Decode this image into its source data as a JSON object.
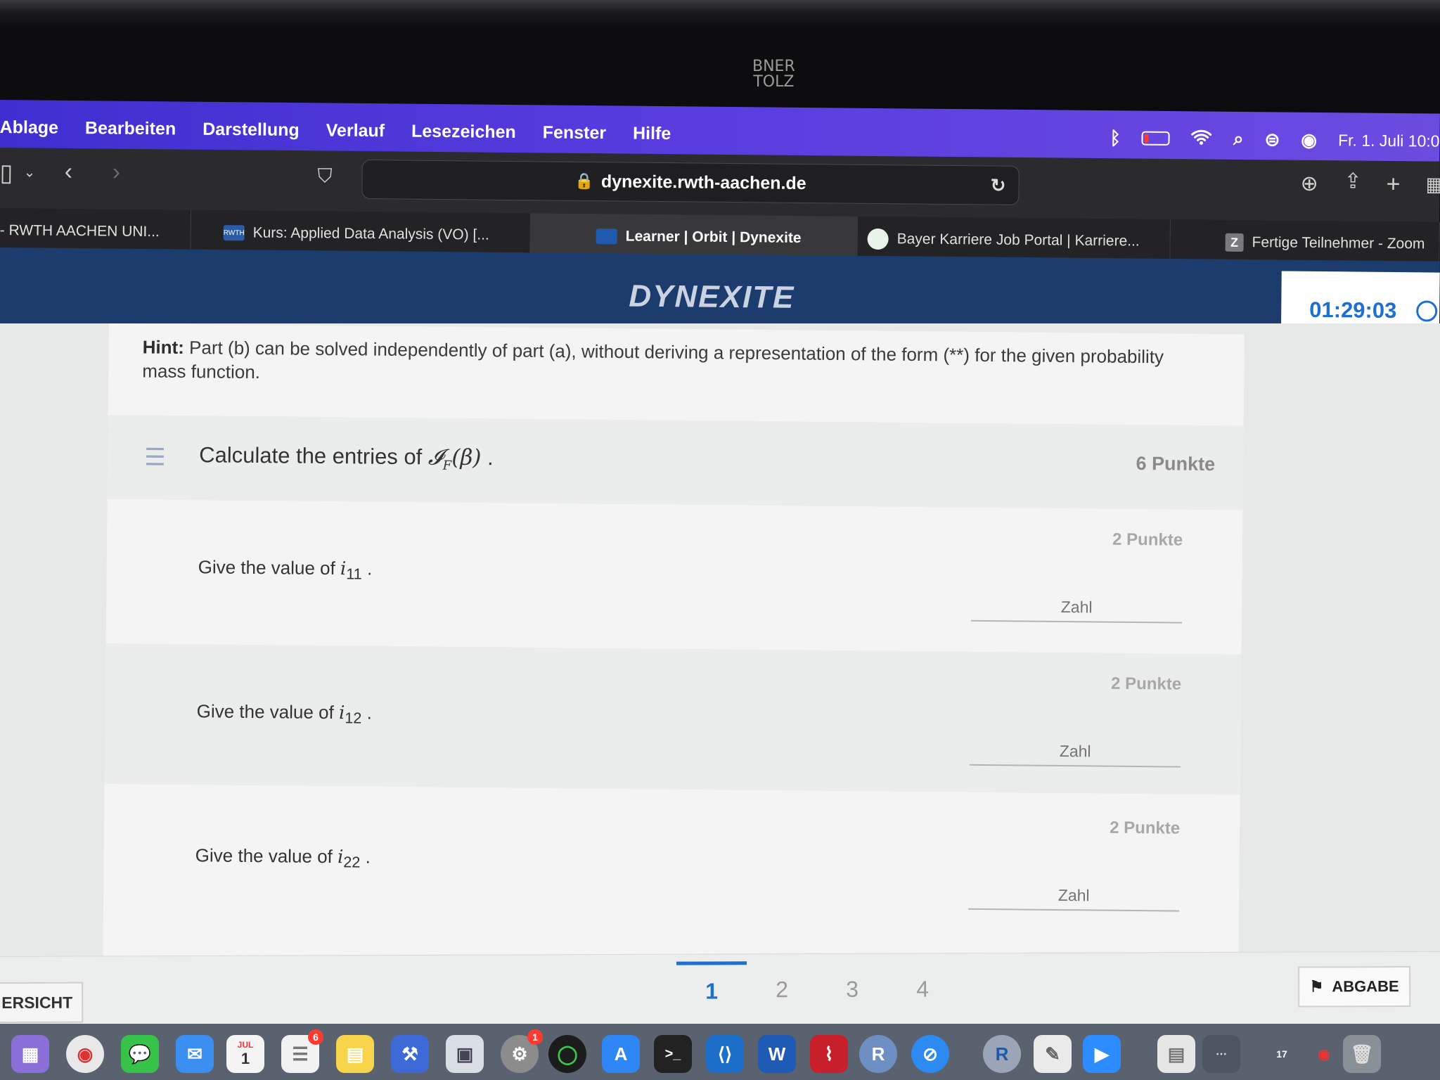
{
  "camera_label": "BNER\nTOLZ",
  "menubar": {
    "items": [
      "Ablage",
      "Bearbeiten",
      "Darstellung",
      "Verlauf",
      "Lesezeichen",
      "Fenster",
      "Hilfe"
    ],
    "datetime": "Fr. 1. Juli  10:0"
  },
  "toolbar": {
    "url": "dynexite.rwth-aachen.de"
  },
  "tabs": [
    {
      "label": "- RWTH AACHEN UNI..."
    },
    {
      "label": "Kurs: Applied Data Analysis (VO) [..."
    },
    {
      "label": "Learner | Orbit | Dynexite"
    },
    {
      "label": "Bayer Karriere Job Portal | Karriere..."
    },
    {
      "label": "Fertige Teilnehmer - Zoom"
    }
  ],
  "tab_favicons": {
    "rwth": "RWTH",
    "zoom": "Z"
  },
  "header": {
    "logo": "DYNEXITE",
    "timer": "01:29:03"
  },
  "hint": {
    "label": "Hint:",
    "text": " Part (b) can be solved independently of part (a), without deriving a representation of the form  (**)  for the given probability mass function."
  },
  "task": {
    "title_prefix": "Calculate the entries of ",
    "title_math": "𝓘_F(β)",
    "title_suffix": " .",
    "points": "6 Punkte"
  },
  "subtasks": [
    {
      "question": "Give the value of ",
      "var": "i",
      "sub": "11",
      "points": "2 Punkte",
      "placeholder": "Zahl"
    },
    {
      "question": "Give the value of ",
      "var": "i",
      "sub": "12",
      "points": "2 Punkte",
      "placeholder": "Zahl"
    },
    {
      "question": "Give the value of ",
      "var": "i",
      "sub": "22",
      "points": "2 Punkte",
      "placeholder": "Zahl"
    }
  ],
  "bottom": {
    "overview": "ERSICHT",
    "pages": [
      "1",
      "2",
      "3",
      "4"
    ],
    "active_page": "1",
    "submit": "ABGABE"
  },
  "dock": {
    "calendar_month": "JUL",
    "calendar_day": "1",
    "badge_reminders": "6",
    "badge_settings": "1",
    "calendar_small": "17"
  },
  "colors": {
    "accent": "#1f6fd0",
    "header": "#1d3c6e",
    "menubar": "#4a34d8"
  }
}
